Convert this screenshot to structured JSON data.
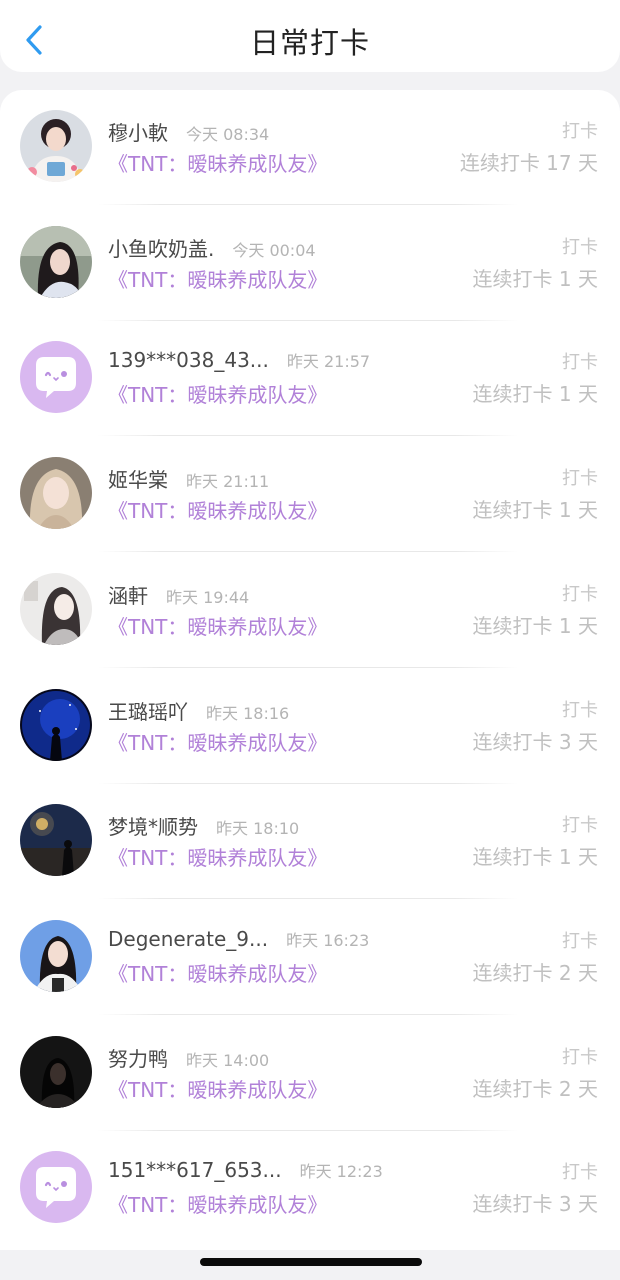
{
  "header": {
    "title": "日常打卡",
    "back_icon": "chevron-left-icon",
    "accent": "#2f9bf0"
  },
  "colors": {
    "book_title": "#b181d8",
    "time": "#b4b4b4",
    "streak": "#c0c0c0"
  },
  "checkins": [
    {
      "name": "穆小軟",
      "time": "今天 08:34",
      "book": "《TNT：暧昧养成队友》",
      "action": "打卡",
      "streak": "连续打卡 17 天",
      "avatar": "photo-girl-white-outfit"
    },
    {
      "name": "小鱼吹奶盖.",
      "time": "今天 00:04",
      "book": "《TNT：暧昧养成队友》",
      "action": "打卡",
      "streak": "连续打卡 1 天",
      "avatar": "photo-girl-dark-hair"
    },
    {
      "name": "139***038_43...",
      "time": "昨天 21:57",
      "book": "《TNT：暧昧养成队友》",
      "action": "打卡",
      "streak": "连续打卡 1 天",
      "avatar": "default-chat-bubble-avatar"
    },
    {
      "name": "姬华棠",
      "time": "昨天 21:11",
      "book": "《TNT：暧昧养成队友》",
      "action": "打卡",
      "streak": "连续打卡 1 天",
      "avatar": "photo-girl-light-hair"
    },
    {
      "name": "涵軒",
      "time": "昨天 19:44",
      "book": "《TNT：暧昧养成队友》",
      "action": "打卡",
      "streak": "连续打卡 1 天",
      "avatar": "photo-girl-pale"
    },
    {
      "name": "王璐瑶吖",
      "time": "昨天 18:16",
      "book": "《TNT：暧昧养成队友》",
      "action": "打卡",
      "streak": "连续打卡 3 天",
      "avatar": "photo-night-sky-blue"
    },
    {
      "name": "梦境*顺势",
      "time": "昨天 18:10",
      "book": "《TNT：暧昧养成队友》",
      "action": "打卡",
      "streak": "连续打卡 1 天",
      "avatar": "photo-night-street"
    },
    {
      "name": "Degenerate_9...",
      "time": "昨天 16:23",
      "book": "《TNT：暧昧养成队友》",
      "action": "打卡",
      "streak": "连续打卡 2 天",
      "avatar": "photo-girl-blue-background"
    },
    {
      "name": "努力鸭",
      "time": "昨天 14:00",
      "book": "《TNT：暧昧养成队友》",
      "action": "打卡",
      "streak": "连续打卡 2 天",
      "avatar": "photo-dark-figure"
    },
    {
      "name": "151***617_653...",
      "time": "昨天 12:23",
      "book": "《TNT：暧昧养成队友》",
      "action": "打卡",
      "streak": "连续打卡 3 天",
      "avatar": "default-chat-bubble-avatar"
    }
  ]
}
